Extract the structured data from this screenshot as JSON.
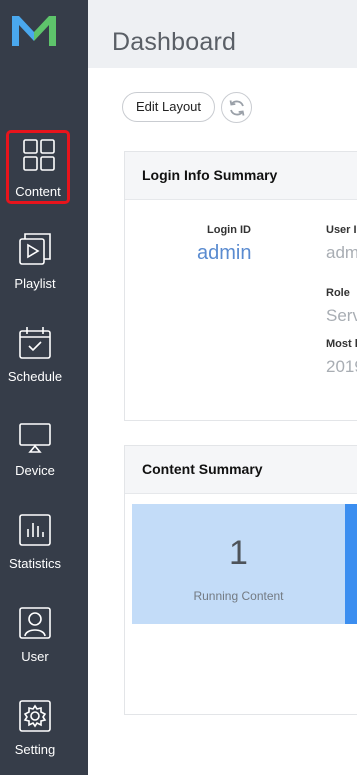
{
  "header": {
    "title": "Dashboard"
  },
  "toolbar": {
    "edit_layout_label": "Edit Layout",
    "refresh_icon": "refresh-icon"
  },
  "sidebar": {
    "logo_icon": "m-logo-icon",
    "selected_color": "#e8141c",
    "items": [
      {
        "label": "Content",
        "icon": "grid-icon",
        "selected": true
      },
      {
        "label": "Playlist",
        "icon": "playlist-icon",
        "selected": false
      },
      {
        "label": "Schedule",
        "icon": "calendar-icon",
        "selected": false
      },
      {
        "label": "Device",
        "icon": "display-icon",
        "selected": false
      },
      {
        "label": "Statistics",
        "icon": "bar-chart-icon",
        "selected": false
      },
      {
        "label": "User",
        "icon": "user-icon",
        "selected": false
      },
      {
        "label": "Setting",
        "icon": "gear-icon",
        "selected": false
      }
    ]
  },
  "login_summary": {
    "title": "Login Info Summary",
    "login_id_label": "Login ID",
    "login_id_value": "admin",
    "user_label": "User I",
    "user_value": "adm",
    "role_label": "Role",
    "role_value": "Serv",
    "most_label": "Most l",
    "most_value": "2019"
  },
  "content_summary": {
    "title": "Content Summary",
    "running_count": "1",
    "running_label": "Running Content"
  },
  "colors": {
    "sidebar_bg": "#363d49",
    "topbar_bg": "#eef0f3",
    "accent_blue": "#5a8bd0",
    "tile_bg": "#c3dcf8",
    "tile_next": "#3b8ef0"
  }
}
